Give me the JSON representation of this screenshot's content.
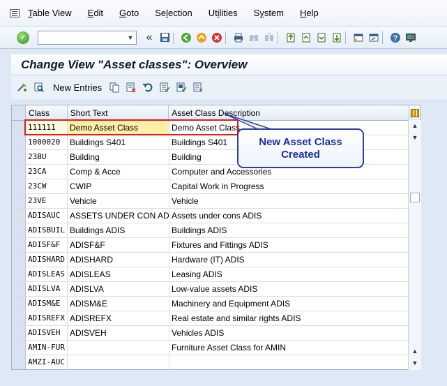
{
  "menu": {
    "items": [
      {
        "label": "Table View",
        "ul": "T"
      },
      {
        "label": "Edit",
        "ul": "E"
      },
      {
        "label": "Goto",
        "ul": "G"
      },
      {
        "label": "Selection",
        "ul": "l"
      },
      {
        "label": "Utilities",
        "ul": "i"
      },
      {
        "label": "System",
        "ul": "y"
      },
      {
        "label": "Help",
        "ul": "H"
      }
    ]
  },
  "toolbar": {
    "command_value": "",
    "back_glyph": "«"
  },
  "title": "Change View \"Asset classes\": Overview",
  "app_toolbar": {
    "new_entries_label": "New Entries"
  },
  "table": {
    "columns": [
      "Class",
      "Short Text",
      "Asset Class Description"
    ],
    "rows": [
      {
        "class": "111111",
        "short": "Demo Asset Class",
        "desc": "Demo Asset Class"
      },
      {
        "class": "1000020",
        "short": "Buildings S401",
        "desc": "Buildings S401"
      },
      {
        "class": "23BU",
        "short": "Building",
        "desc": "Building"
      },
      {
        "class": "23CA",
        "short": "Comp & Acce",
        "desc": "Computer and Accessories"
      },
      {
        "class": "23CW",
        "short": "CWIP",
        "desc": "Capital Work in Progress"
      },
      {
        "class": "23VE",
        "short": "Vehicle",
        "desc": "Vehicle"
      },
      {
        "class": "ADISAUC",
        "short": "ASSETS UNDER CON ADI",
        "desc": "Assets under cons ADIS"
      },
      {
        "class": "ADISBUIL",
        "short": "Buildings ADIS",
        "desc": "Buildings ADIS"
      },
      {
        "class": "ADISF&F",
        "short": "ADISF&F",
        "desc": "Fixtures and Fittings ADIS"
      },
      {
        "class": "ADISHARD",
        "short": "ADISHARD",
        "desc": "Hardware (IT) ADIS"
      },
      {
        "class": "ADISLEAS",
        "short": "ADISLEAS",
        "desc": "Leasing ADIS"
      },
      {
        "class": "ADISLVA",
        "short": "ADISLVA",
        "desc": "Low-value assets ADIS"
      },
      {
        "class": "ADISM&E",
        "short": "ADISM&E",
        "desc": "Machinery and Equipment ADIS"
      },
      {
        "class": "ADISREFX",
        "short": "ADISREFX",
        "desc": "Real estate and similar rights ADIS"
      },
      {
        "class": "ADISVEH",
        "short": "ADISVEH",
        "desc": "Vehicles ADIS"
      },
      {
        "class": "AMIN-FUR",
        "short": "",
        "desc": "Furniture Asset Class for AMIN"
      },
      {
        "class": "AMZI-AUC",
        "short": "",
        "desc": ""
      }
    ]
  },
  "callout": {
    "line1": "New Asset Class",
    "line2": "Created"
  }
}
